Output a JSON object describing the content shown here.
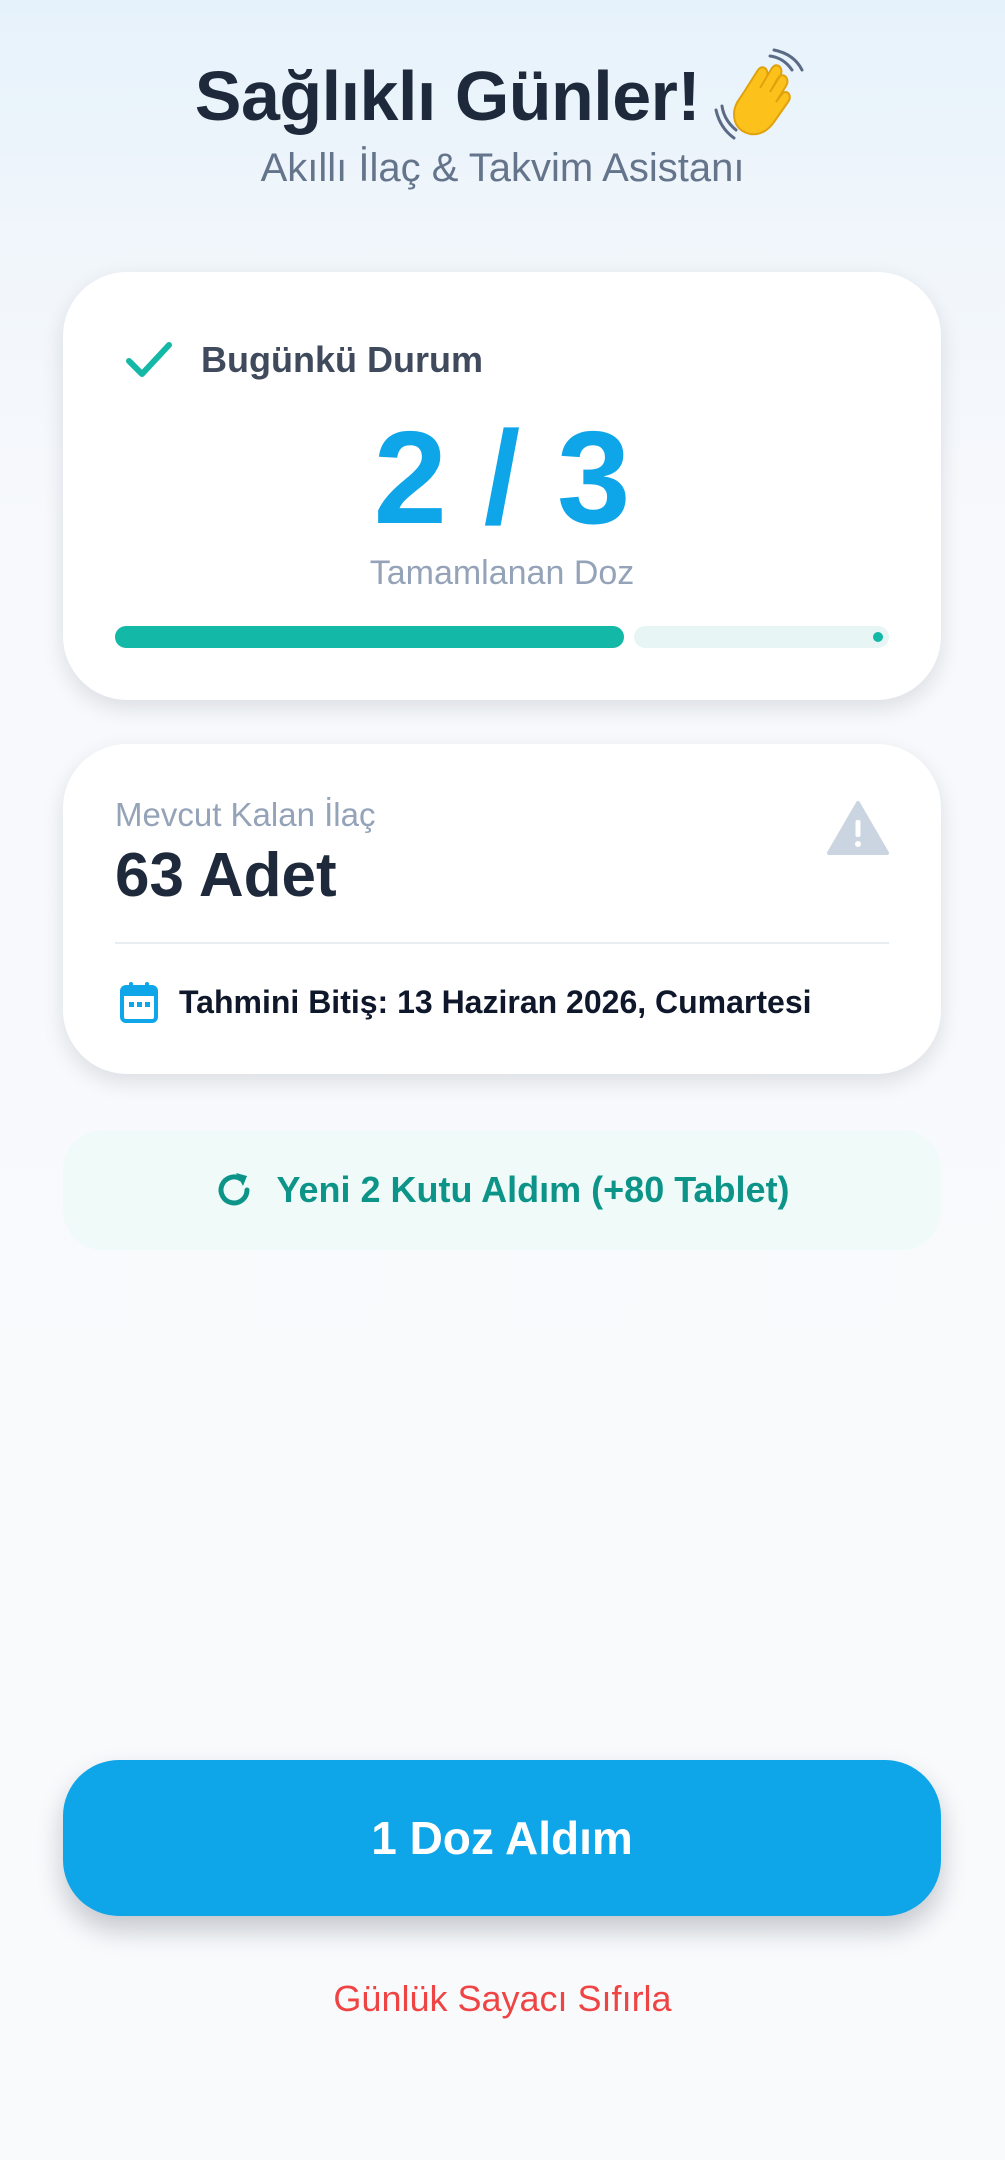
{
  "header": {
    "title": "Sağlıklı Günler!",
    "subtitle": "Akıllı İlaç & Takvim Asistanı",
    "emoji_icon": "waving-hand-icon"
  },
  "status_card": {
    "label": "Bugünkü Durum",
    "dose_text": "2 / 3",
    "doses_taken": 2,
    "doses_total": 3,
    "caption": "Tamamlanan Doz",
    "icon": "check-icon"
  },
  "stock_card": {
    "label": "Mevcut Kalan İlaç",
    "value": "63 Adet",
    "warning_icon": "warning-icon",
    "finish_text": "Tahmini Bitiş: 13 Haziran 2026, Cumartesi",
    "calendar_icon": "calendar-icon"
  },
  "refill_button": {
    "label": "Yeni 2 Kutu Aldım (+80 Tablet)",
    "icon": "refresh-icon"
  },
  "dose_button": {
    "label": "1 Doz Aldım"
  },
  "reset_link": {
    "label": "Günlük Sayacı Sıfırla"
  },
  "colors": {
    "primary": "#0ea5e9",
    "teal": "#14b8a6",
    "teal_dark": "#0d9488",
    "danger": "#ef4444",
    "text_dark": "#1e293b",
    "text_muted": "#94a3b8"
  }
}
